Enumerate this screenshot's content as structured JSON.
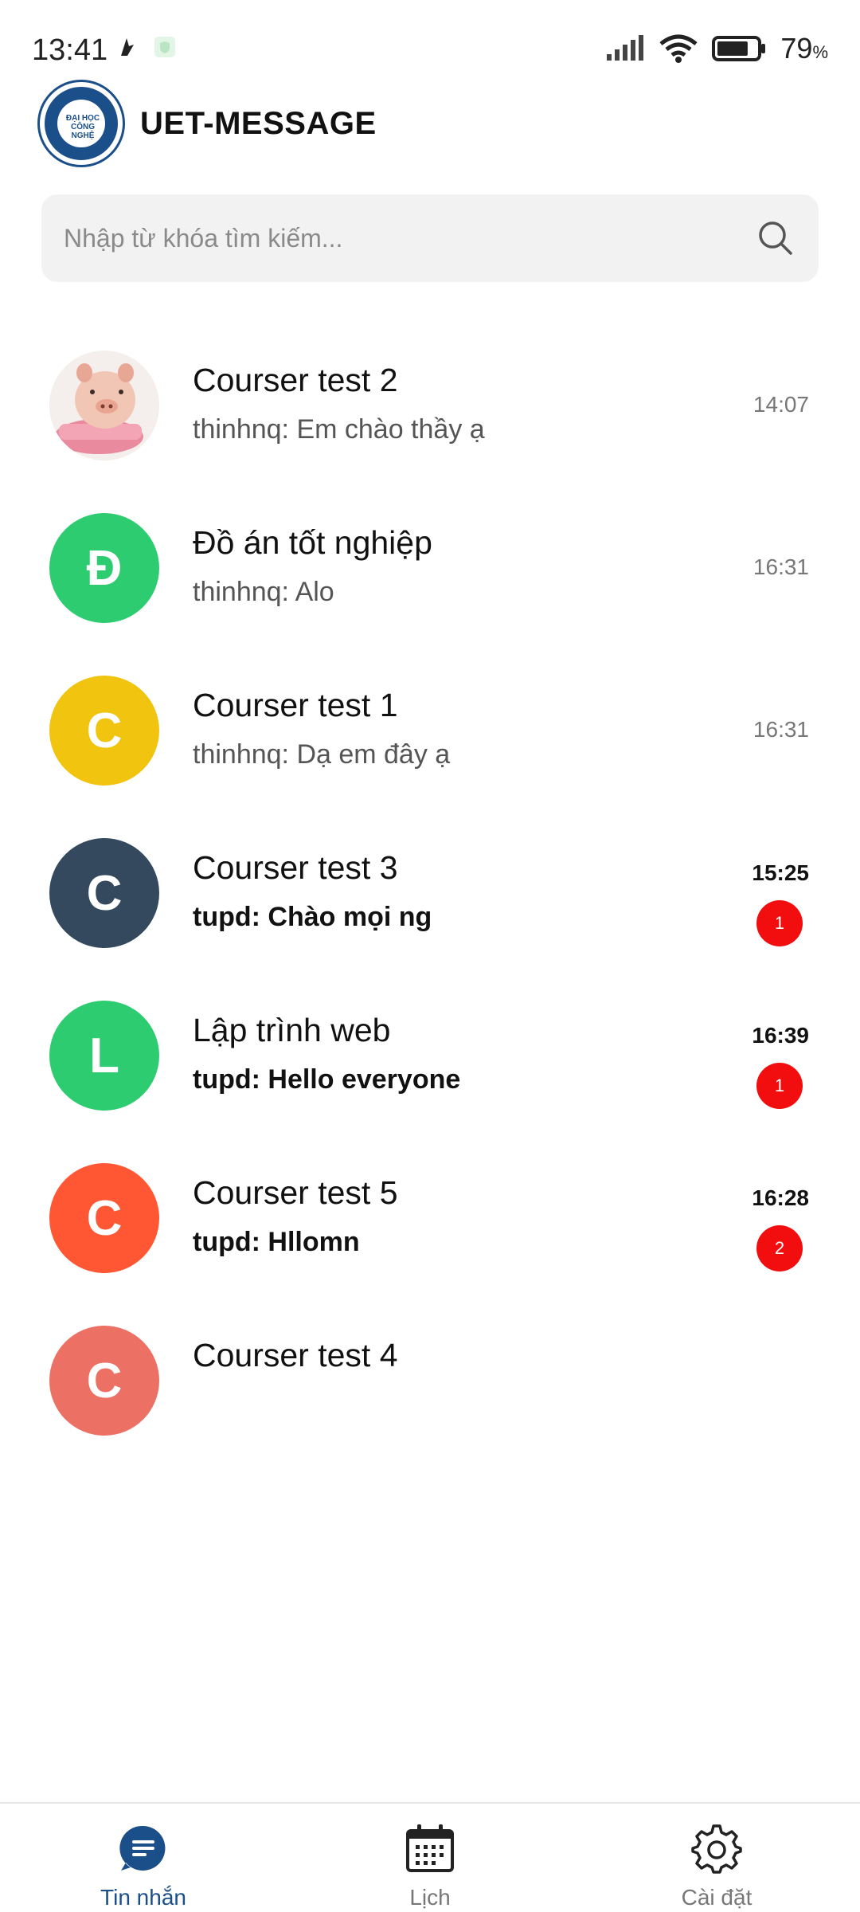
{
  "status_bar": {
    "time": "13:41",
    "battery_percent": "79",
    "battery_unit": "%",
    "battery_level": 0.79
  },
  "header": {
    "logo_text": "ĐẠI HỌC CÔNG NGHỆ",
    "title": "UET-MESSAGE"
  },
  "search": {
    "placeholder": "Nhập từ khóa tìm kiếm..."
  },
  "conversations": [
    {
      "name": "Courser test 2",
      "preview": "thinhnq: Em chào thầy ạ",
      "time": "14:07",
      "unread": false,
      "avatar_type": "photo",
      "avatar_icon": "pig-plush-icon"
    },
    {
      "name": "Đồ án tốt nghiệp",
      "preview": "thinhnq: Alo",
      "time": "16:31",
      "unread": false,
      "avatar_letter": "Đ",
      "avatar_color": "#2ecc71"
    },
    {
      "name": "Courser test 1",
      "preview": "thinhnq: Dạ em đây ạ",
      "time": "16:31",
      "unread": false,
      "avatar_letter": "C",
      "avatar_color": "#f1c40f"
    },
    {
      "name": "Courser test 3",
      "preview": "tupd: Chào mọi ng",
      "time": "15:25",
      "unread": true,
      "badge": "1",
      "avatar_letter": "C",
      "avatar_color": "#34495e"
    },
    {
      "name": "Lập trình web",
      "preview": "tupd: Hello everyone",
      "time": "16:39",
      "unread": true,
      "badge": "1",
      "avatar_letter": "L",
      "avatar_color": "#2ecc71"
    },
    {
      "name": "Courser test 5",
      "preview": "tupd: Hllomn",
      "time": "16:28",
      "unread": true,
      "badge": "2",
      "avatar_letter": "C",
      "avatar_color": "#ff5733"
    },
    {
      "name": "Courser test 4",
      "preview": "",
      "time": "",
      "unread": false,
      "avatar_letter": "C",
      "avatar_color": "#ec7063"
    }
  ],
  "bottom_nav": {
    "items": [
      {
        "label": "Tin nhắn",
        "icon": "chat-icon",
        "active": true
      },
      {
        "label": "Lịch",
        "icon": "calendar-icon",
        "active": false
      },
      {
        "label": "Cài đặt",
        "icon": "gear-icon",
        "active": false
      }
    ]
  },
  "colors": {
    "brand": "#1b4f8a",
    "badge": "#f20e0e",
    "search_bg": "#f2f2f2"
  }
}
